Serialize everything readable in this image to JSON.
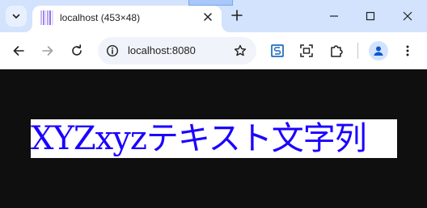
{
  "tab": {
    "title": "localhost (453×48)"
  },
  "toolbar": {
    "url": "localhost:8080"
  },
  "page": {
    "sample_text": "XYZxyzテキスト文字列"
  },
  "icons": {
    "tab_search": "chevron-down-icon",
    "tab_close": "close-icon",
    "new_tab": "plus-icon",
    "minimize": "minimize-icon",
    "maximize": "maximize-icon",
    "close_window": "close-icon",
    "back": "arrow-left-icon",
    "forward": "arrow-right-icon",
    "reload": "reload-icon",
    "site_info": "info-icon",
    "bookmark": "star-icon",
    "extension_s": "s-extension-icon",
    "screenshot": "screenshot-icon",
    "extensions": "puzzle-icon",
    "profile": "person-icon",
    "menu": "kebab-menu-icon"
  },
  "colors": {
    "tabstrip": "#d3e3fd",
    "page_background": "#0f0f0f",
    "text_color": "#1a00ff",
    "text_background": "#ffffff"
  }
}
